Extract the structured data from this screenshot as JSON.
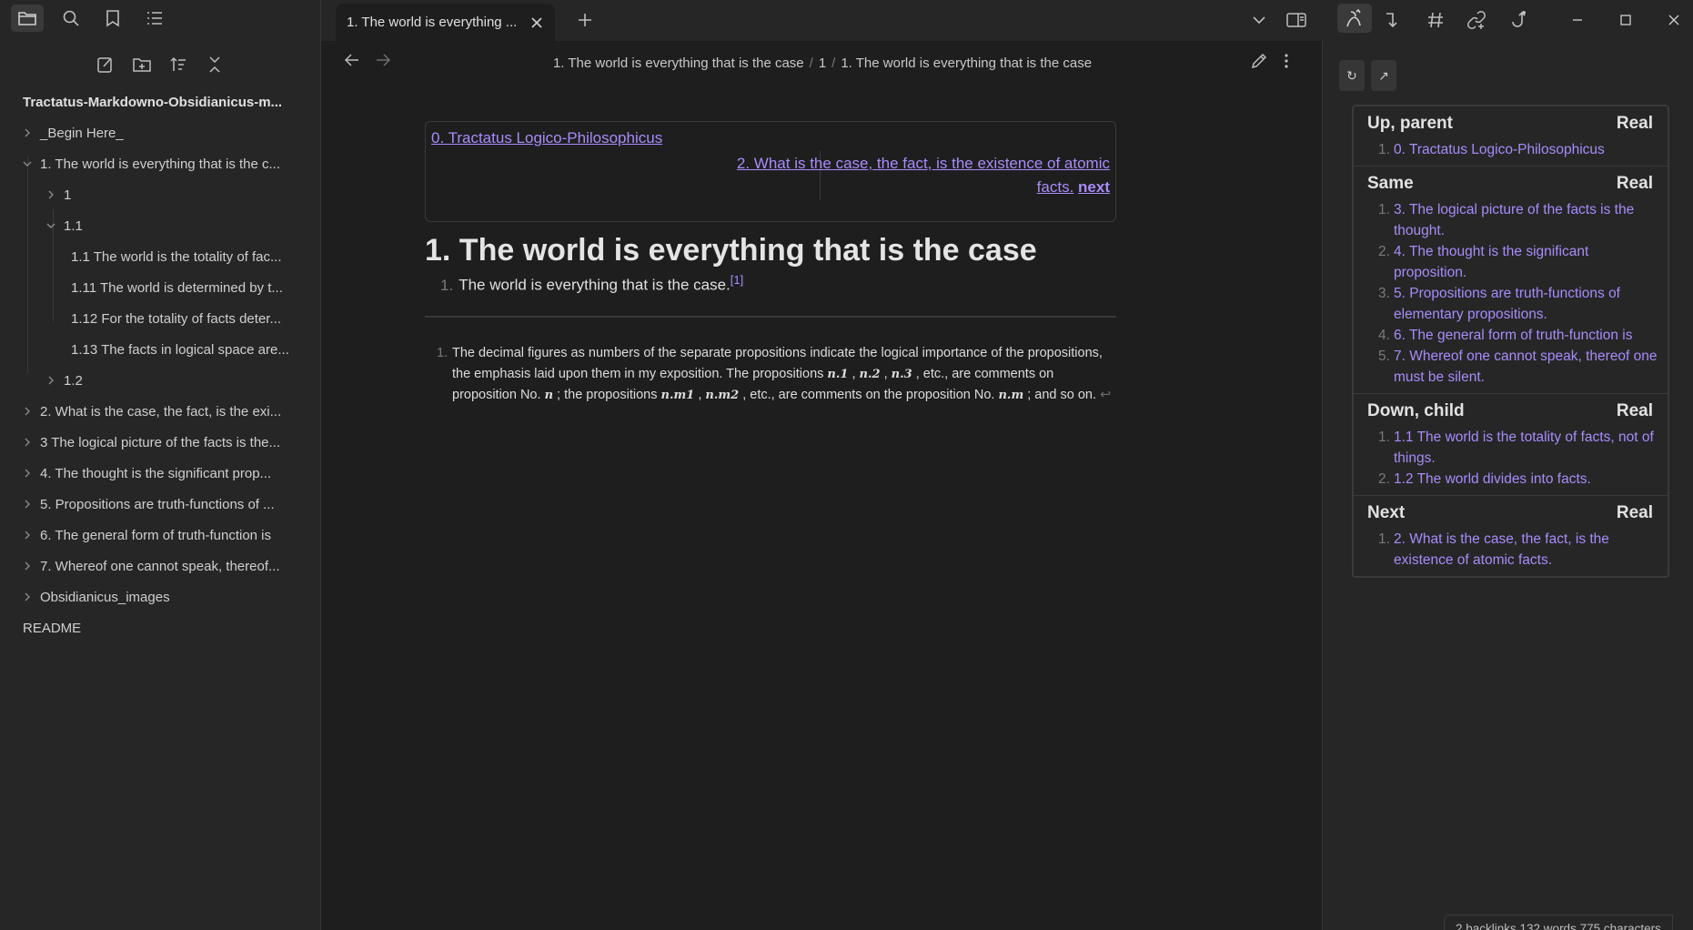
{
  "window": {
    "tab_title": "1. The world is everything ...",
    "controls": [
      "minimize",
      "maximize",
      "close"
    ]
  },
  "left_sidebar": {
    "vault_name": "Tractatus-Markdowno-Obsidianicus-m...",
    "tree": [
      {
        "label": "_Begin Here_",
        "expanded": false
      },
      {
        "label": "1. The world is everything that is the c...",
        "expanded": true
      },
      {
        "label": "1",
        "expanded": false
      },
      {
        "label": "1.1",
        "expanded": true
      },
      {
        "label": "1.1 The world is the totality of fac..."
      },
      {
        "label": "1.11 The world is determined by t..."
      },
      {
        "label": "1.12 For the totality of facts deter..."
      },
      {
        "label": "1.13 The facts in logical space are..."
      },
      {
        "label": "1.2",
        "expanded": false
      },
      {
        "label": "2. What is the case, the fact, is the exi...",
        "expanded": false
      },
      {
        "label": "3 The logical picture of the facts is the...",
        "expanded": false
      },
      {
        "label": "4. The thought is the significant prop...",
        "expanded": false
      },
      {
        "label": "5. Propositions are truth-functions of ...",
        "expanded": false
      },
      {
        "label": "6. The general form of truth-function is",
        "expanded": false
      },
      {
        "label": "7. Whereof one cannot speak, thereof...",
        "expanded": false
      },
      {
        "label": "Obsidianicus_images",
        "expanded": false
      },
      {
        "label": "README"
      }
    ]
  },
  "main": {
    "breadcrumb": [
      "1. The world is everything that is the case",
      "1",
      "1. The world is everything that is the case"
    ],
    "breadcrumb_sep": "/",
    "nav_up": "0. Tractatus Logico-Philosophicus",
    "nav_next_line1": "2. What is the case, the fact, is the existence of atomic",
    "nav_next_line2": "facts.",
    "nav_next_label": "next",
    "title": "1. The world is everything that is the case",
    "list_num": "1.",
    "list_text": "The world is everything that is the case.",
    "footnote_ref": "[1]",
    "footnote": {
      "num": "1.",
      "part1": "The decimal figures as numbers of the separate propositions indicate the logical importance of the propositions, the emphasis laid upon them in my exposition. The propositions ",
      "m1": "n.1",
      "c1": " , ",
      "m2": "n.2",
      "c2": " , ",
      "m3": "n.3",
      "part2": " , etc., are comments on proposition No. ",
      "m4": "n",
      "part3": " ; the propositions ",
      "m5": "n.m1",
      "c3": " , ",
      "m6": "n.m2",
      "part4": " , etc., are comments on the proposition No. ",
      "m7": "n.m",
      "part5": " ; and so on. ",
      "back": "↩"
    }
  },
  "right_sidebar": {
    "refresh_label": "↻",
    "open_label": "↗",
    "sections": [
      {
        "title": "Up, parent",
        "tag": "Real",
        "items": [
          "0. Tractatus Logico-Philosophicus"
        ]
      },
      {
        "title": "Same",
        "tag": "Real",
        "items": [
          "3. The logical picture of the facts is the thought.",
          "4. The thought is the significant proposition.",
          "5. Propositions are truth-functions of elementary propositions.",
          "6. The general form of truth-function is",
          "7. Whereof one cannot speak, thereof one must be silent."
        ]
      },
      {
        "title": "Down, child",
        "tag": "Real",
        "items": [
          "1.1 The world is the totality of facts, not of things.",
          "1.2 The world divides into facts."
        ]
      },
      {
        "title": "Next",
        "tag": "Real",
        "items": [
          "2. What is the case, the fact, is the existence of atomic facts."
        ]
      }
    ]
  },
  "status_bar": {
    "text": "2 backlinks   132 words   775 characters"
  },
  "colors": {
    "accent": "#a88bfa",
    "background": "#1e1e1e",
    "sidebar": "#262626"
  }
}
